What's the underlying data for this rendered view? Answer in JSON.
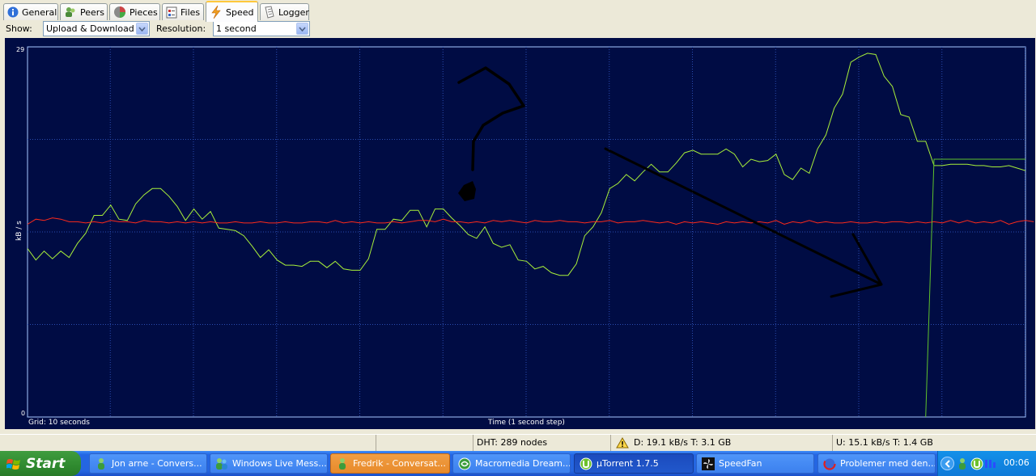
{
  "tabs": [
    {
      "label": "General",
      "icon": "info-icon"
    },
    {
      "label": "Peers",
      "icon": "peers-icon"
    },
    {
      "label": "Pieces",
      "icon": "pieces-icon"
    },
    {
      "label": "Files",
      "icon": "files-icon"
    },
    {
      "label": "Speed",
      "icon": "lightning-icon",
      "active": true
    },
    {
      "label": "Logger",
      "icon": "logger-icon"
    }
  ],
  "toolbar": {
    "show_label": "Show:",
    "show_value": "Upload & Download",
    "resolution_label": "Resolution:",
    "resolution_value": "1 second"
  },
  "graph": {
    "y_max_label": "29",
    "y_min_label": "0",
    "y_axis_label": "kB / s",
    "grid_label": "Grid: 10 seconds",
    "x_axis_label": "Time (1 second step)",
    "colors": {
      "background": "#000c44",
      "grid": "#2a4db0",
      "download": "#a8f03a",
      "upload": "#ff2a1a",
      "border": "#a8c8ff"
    }
  },
  "chart_data": {
    "type": "line",
    "xlabel": "Time (1 second step)",
    "ylabel": "kB / s",
    "ylim": [
      0,
      29
    ],
    "grid": "10 seconds",
    "series": [
      {
        "color": "#a8f03a",
        "values": [
          13.2,
          12.3,
          13.0,
          12.4,
          13.0,
          12.5,
          13.6,
          14.4,
          15.8,
          15.8,
          16.6,
          15.5,
          15.4,
          16.7,
          17.4,
          17.9,
          17.9,
          17.3,
          16.5,
          15.4,
          16.3,
          15.5,
          16.1,
          14.8,
          14.7,
          14.6,
          14.2,
          13.4,
          12.5,
          13.1,
          12.3,
          11.9,
          11.9,
          11.8,
          12.2,
          12.2,
          11.7,
          12.2,
          11.6,
          11.5,
          11.5,
          12.4,
          14.7,
          14.7,
          15.5,
          15.4,
          16.2,
          16.2,
          14.9,
          16.3,
          16.3,
          15.6,
          15.0,
          14.3,
          14.0,
          14.9,
          13.6,
          13.3,
          13.5,
          12.3,
          12.2,
          11.6,
          11.8,
          11.3,
          11.1,
          11.1,
          12.0,
          14.2,
          14.9,
          16.0,
          17.9,
          18.3,
          19.0,
          18.5,
          19.2,
          19.8,
          19.2,
          19.2,
          19.9,
          20.7,
          20.9,
          20.6,
          20.6,
          20.6,
          21.0,
          20.6,
          19.6,
          20.2,
          20.0,
          20.1,
          20.6,
          19.0,
          18.6,
          19.5,
          19.1,
          21.0,
          22.1,
          24.2,
          25.3,
          27.8,
          28.2,
          28.5,
          28.4,
          26.7,
          25.9,
          23.7,
          23.5,
          21.6,
          21.6,
          19.7,
          19.7,
          19.8,
          19.8,
          19.8,
          19.7,
          19.7,
          19.6,
          19.6,
          19.7,
          19.5,
          19.3
        ]
      },
      {
        "color": "#ff2a1a",
        "values": [
          15.1,
          15.5,
          15.4,
          15.6,
          15.5,
          15.3,
          15.3,
          15.2,
          15.3,
          15.2,
          15.4,
          15.3,
          15.3,
          15.2,
          15.4,
          15.3,
          15.3,
          15.2,
          15.3,
          15.2,
          15.3,
          15.2,
          15.3,
          15.2,
          15.2,
          15.3,
          15.2,
          15.2,
          15.3,
          15.2,
          15.2,
          15.3,
          15.2,
          15.2,
          15.3,
          15.3,
          15.2,
          15.4,
          15.2,
          15.3,
          15.2,
          15.3,
          15.2,
          15.2,
          15.3,
          15.2,
          15.3,
          15.4,
          15.4,
          15.3,
          15.5,
          15.3,
          15.3,
          15.2,
          15.3,
          15.2,
          15.4,
          15.3,
          15.4,
          15.3,
          15.2,
          15.4,
          15.3,
          15.3,
          15.4,
          15.3,
          15.3,
          15.2,
          15.3,
          15.3,
          15.4,
          15.2,
          15.3,
          15.3,
          15.4,
          15.3,
          15.2,
          15.3,
          15.1,
          15.3,
          15.2,
          15.3,
          15.2,
          15.1,
          15.3,
          15.2,
          15.3,
          15.2,
          15.3,
          15.2,
          15.4,
          15.1,
          15.3,
          15.2,
          15.4,
          15.2,
          15.3,
          15.2,
          15.2,
          15.3,
          15.2,
          15.2,
          15.3,
          15.2,
          15.3,
          15.3,
          15.2,
          15.3,
          15.2,
          15.3,
          15.2,
          15.4,
          15.2,
          15.4,
          15.2,
          15.3,
          15.2,
          15.4,
          15.1,
          15.3,
          15.4,
          15.3
        ]
      },
      {
        "color": "#5fc22c",
        "values": [
          null,
          null,
          null,
          null,
          null,
          null,
          null,
          null,
          null,
          null,
          null,
          null,
          null,
          null,
          null,
          null,
          null,
          null,
          null,
          null,
          null,
          null,
          null,
          null,
          null,
          null,
          null,
          null,
          null,
          null,
          null,
          null,
          null,
          null,
          null,
          null,
          null,
          null,
          null,
          null,
          null,
          null,
          null,
          null,
          null,
          null,
          null,
          null,
          null,
          null,
          null,
          null,
          null,
          null,
          null,
          null,
          null,
          null,
          null,
          null,
          null,
          null,
          null,
          null,
          null,
          null,
          null,
          null,
          null,
          null,
          null,
          null,
          null,
          null,
          null,
          null,
          null,
          null,
          null,
          null,
          null,
          null,
          null,
          null,
          null,
          null,
          null,
          null,
          null,
          null,
          null,
          null,
          null,
          null,
          null,
          null,
          null,
          null,
          null,
          null,
          null,
          null,
          null,
          null,
          null,
          null,
          null,
          null,
          0,
          20.2,
          20.2,
          20.2,
          20.2,
          20.2,
          20.2,
          20.2,
          20.2,
          20.2,
          20.2,
          20.2,
          20.2
        ]
      }
    ]
  },
  "statusbar": {
    "dht": "DHT: 289 nodes",
    "download": "D: 19.1 kB/s T: 3.1 GB",
    "upload": "U: 15.1 kB/s T: 1.4 GB"
  },
  "taskbar": {
    "start_label": "Start",
    "buttons": [
      {
        "label": "Jon arne - Convers...",
        "icon": "messenger-icon"
      },
      {
        "label": "Windows Live Mess...",
        "icon": "messenger-icon"
      },
      {
        "label": "Fredrik - Conversat...",
        "icon": "messenger-icon",
        "state": "flashing"
      },
      {
        "label": "Macromedia Dream...",
        "icon": "dreamweaver-icon"
      },
      {
        "label": "µTorrent 1.7.5",
        "icon": "utorrent-icon",
        "state": "active"
      },
      {
        "label": "SpeedFan",
        "icon": "speedfan-icon"
      },
      {
        "label": "Problemer med den...",
        "icon": "browser-icon"
      }
    ],
    "clock": "00:06"
  }
}
